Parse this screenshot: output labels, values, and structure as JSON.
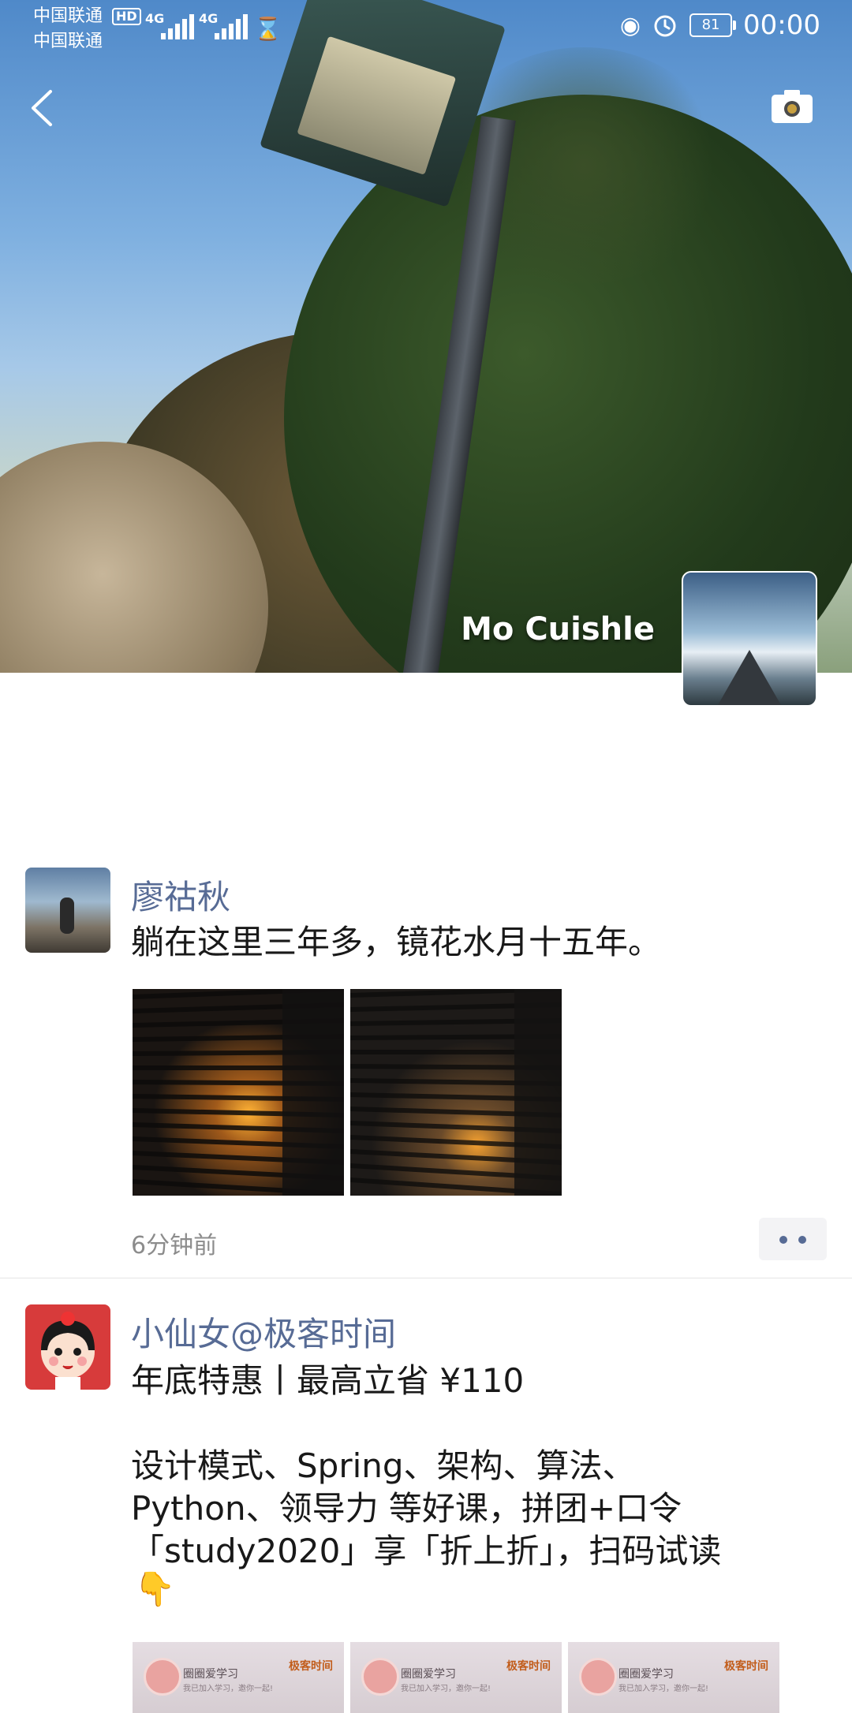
{
  "status_bar": {
    "carrier_1": "中国联通",
    "carrier_2": "中国联通",
    "hd_badge": "HD",
    "network_1": "4G",
    "network_2": "4G",
    "battery": "81",
    "time": "00:00"
  },
  "cover": {
    "user_name": "Mo Cuishle"
  },
  "posts": [
    {
      "author": "廖祜秋",
      "text": "躺在这里三年多，镜花水月十五年。",
      "time": "6分钟前"
    },
    {
      "author": "小仙女@极客时间",
      "text": "年底特惠丨最高立省 ¥110\n\n设计模式、Spring、架构、算法、\nPython、领导力 等好课，拼团+口令\n「study2020」享「折上折」，扫码试读",
      "emoji": "👇",
      "thumb_title": "圈圈爱学习",
      "thumb_sub": "我已加入学习，邀你一起!",
      "thumb_brand": "极客时间"
    }
  ],
  "colors": {
    "name_link": "#576b95",
    "text": "#191919",
    "time": "#8c8c8c"
  }
}
